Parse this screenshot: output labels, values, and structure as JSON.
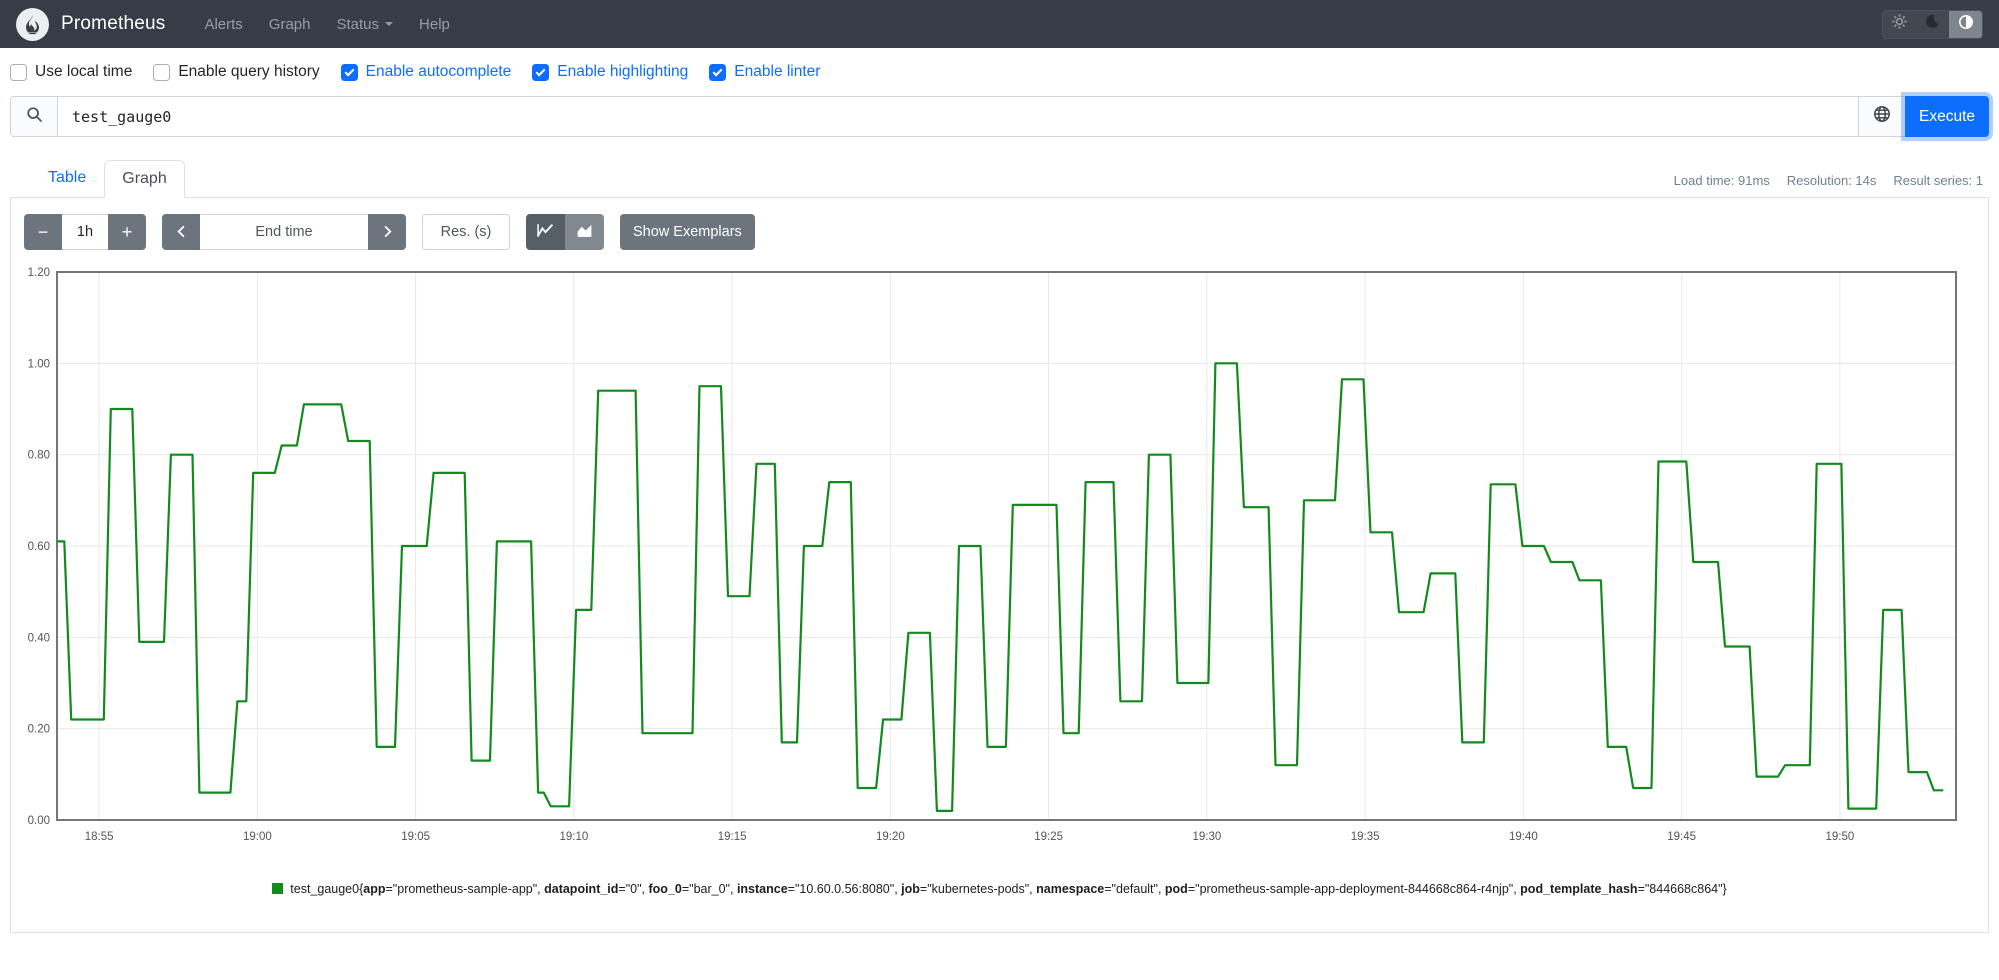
{
  "navbar": {
    "brand": "Prometheus",
    "links": [
      {
        "label": "Alerts",
        "caret": false
      },
      {
        "label": "Graph",
        "caret": false
      },
      {
        "label": "Status",
        "caret": true
      },
      {
        "label": "Help",
        "caret": false
      }
    ],
    "theme_buttons": [
      {
        "icon": "gear-icon",
        "active": false
      },
      {
        "icon": "moon-icon",
        "active": false
      },
      {
        "icon": "contrast-icon",
        "active": true
      }
    ]
  },
  "options": [
    {
      "label": "Use local time",
      "checked": false
    },
    {
      "label": "Enable query history",
      "checked": false
    },
    {
      "label": "Enable autocomplete",
      "checked": true
    },
    {
      "label": "Enable highlighting",
      "checked": true
    },
    {
      "label": "Enable linter",
      "checked": true
    }
  ],
  "query": {
    "value": "test_gauge0",
    "execute_label": "Execute"
  },
  "tabs": [
    {
      "label": "Table",
      "active": false
    },
    {
      "label": "Graph",
      "active": true
    }
  ],
  "stats": [
    "Load time: 91ms",
    "Resolution: 14s",
    "Result series: 1"
  ],
  "graph_controls": {
    "range_decrease": "−",
    "range_value": "1h",
    "range_increase": "+",
    "end_time_placeholder": "End time",
    "res_placeholder": "Res. (s)",
    "show_exemplars": "Show Exemplars"
  },
  "chart_data": {
    "type": "line",
    "style": "step-after",
    "grid": true,
    "legend_position": "bottom",
    "ylim": [
      0.0,
      1.2
    ],
    "y_ticks": [
      0.0,
      0.2,
      0.4,
      0.6,
      0.8,
      1.0,
      1.2
    ],
    "x_range_minutes": [
      0,
      60
    ],
    "x_ticks": [
      {
        "label": "18:55",
        "t": 1.33
      },
      {
        "label": "19:00",
        "t": 6.33
      },
      {
        "label": "19:05",
        "t": 11.33
      },
      {
        "label": "19:10",
        "t": 16.33
      },
      {
        "label": "19:15",
        "t": 21.33
      },
      {
        "label": "19:20",
        "t": 26.33
      },
      {
        "label": "19:25",
        "t": 31.33
      },
      {
        "label": "19:30",
        "t": 36.33
      },
      {
        "label": "19:35",
        "t": 41.33
      },
      {
        "label": "19:40",
        "t": 46.33
      },
      {
        "label": "19:45",
        "t": 51.33
      },
      {
        "label": "19:50",
        "t": 56.33
      }
    ],
    "series": [
      {
        "name": "test_gauge0{app=\"prometheus-sample-app\", datapoint_id=\"0\", foo_0=\"bar_0\", instance=\"10.60.0.56:8080\", job=\"kubernetes-pods\", namespace=\"default\", pod=\"prometheus-sample-app-deployment-844668c864-r4njp\", pod_template_hash=\"844668c864\"}",
        "color": "#128a1d",
        "end_t": 59.6,
        "plateaus": [
          [
            0.0,
            0.61
          ],
          [
            0.45,
            0.22
          ],
          [
            1.7,
            0.9
          ],
          [
            2.6,
            0.39
          ],
          [
            3.6,
            0.8
          ],
          [
            4.5,
            0.06
          ],
          [
            5.7,
            0.26
          ],
          [
            6.2,
            0.76
          ],
          [
            7.1,
            0.82
          ],
          [
            7.8,
            0.91
          ],
          [
            9.2,
            0.83
          ],
          [
            10.1,
            0.16
          ],
          [
            10.9,
            0.6
          ],
          [
            11.9,
            0.76
          ],
          [
            13.1,
            0.13
          ],
          [
            13.9,
            0.61
          ],
          [
            15.2,
            0.06
          ],
          [
            15.6,
            0.03
          ],
          [
            16.4,
            0.46
          ],
          [
            17.1,
            0.94
          ],
          [
            18.5,
            0.19
          ],
          [
            20.3,
            0.95
          ],
          [
            21.2,
            0.49
          ],
          [
            22.1,
            0.78
          ],
          [
            22.9,
            0.17
          ],
          [
            23.6,
            0.6
          ],
          [
            24.4,
            0.74
          ],
          [
            25.3,
            0.07
          ],
          [
            26.1,
            0.22
          ],
          [
            26.9,
            0.41
          ],
          [
            27.8,
            0.02
          ],
          [
            28.5,
            0.6
          ],
          [
            29.4,
            0.16
          ],
          [
            30.2,
            0.69
          ],
          [
            31.8,
            0.19
          ],
          [
            32.5,
            0.74
          ],
          [
            33.6,
            0.26
          ],
          [
            34.5,
            0.8
          ],
          [
            35.4,
            0.3
          ],
          [
            36.6,
            1.0
          ],
          [
            37.5,
            0.685
          ],
          [
            38.5,
            0.12
          ],
          [
            39.4,
            0.7
          ],
          [
            40.6,
            0.965
          ],
          [
            41.5,
            0.63
          ],
          [
            42.4,
            0.455
          ],
          [
            43.4,
            0.54
          ],
          [
            44.4,
            0.17
          ],
          [
            45.3,
            0.735
          ],
          [
            46.3,
            0.6
          ],
          [
            47.2,
            0.565
          ],
          [
            48.1,
            0.525
          ],
          [
            49.0,
            0.16
          ],
          [
            49.8,
            0.07
          ],
          [
            50.6,
            0.785
          ],
          [
            51.7,
            0.565
          ],
          [
            52.7,
            0.38
          ],
          [
            53.7,
            0.095
          ],
          [
            54.6,
            0.12
          ],
          [
            55.6,
            0.78
          ],
          [
            56.6,
            0.025
          ],
          [
            57.7,
            0.46
          ],
          [
            58.5,
            0.105
          ],
          [
            59.3,
            0.065
          ]
        ]
      }
    ]
  },
  "legend": {
    "swatch_color": "#128a1d",
    "segments": [
      {
        "t": "test_gauge0{",
        "b": false
      },
      {
        "t": "app",
        "b": true
      },
      {
        "t": "=\"prometheus-sample-app\", ",
        "b": false
      },
      {
        "t": "datapoint_id",
        "b": true
      },
      {
        "t": "=\"0\", ",
        "b": false
      },
      {
        "t": "foo_0",
        "b": true
      },
      {
        "t": "=\"bar_0\", ",
        "b": false
      },
      {
        "t": "instance",
        "b": true
      },
      {
        "t": "=\"10.60.0.56:8080\", ",
        "b": false
      },
      {
        "t": "job",
        "b": true
      },
      {
        "t": "=\"kubernetes-pods\", ",
        "b": false
      },
      {
        "t": "namespace",
        "b": true
      },
      {
        "t": "=\"default\", ",
        "b": false
      },
      {
        "t": "pod",
        "b": true
      },
      {
        "t": "=\"prometheus-sample-app-deployment-844668c864-r4njp\", ",
        "b": false
      },
      {
        "t": "pod_template_hash",
        "b": true
      },
      {
        "t": "=\"844668c864\"}",
        "b": false
      }
    ]
  }
}
